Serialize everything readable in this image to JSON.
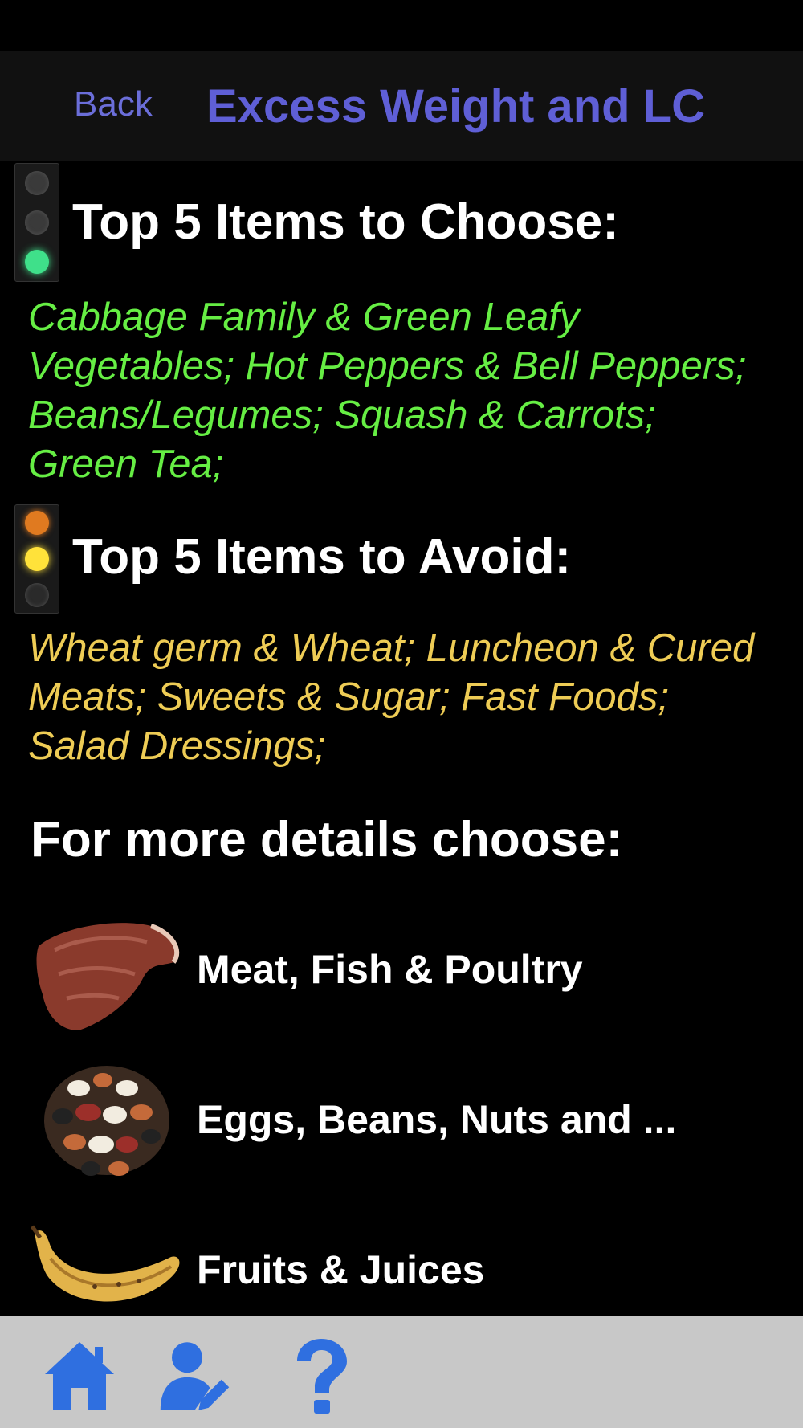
{
  "nav": {
    "back_label": "Back",
    "title": "Excess Weight and LC"
  },
  "choose_section": {
    "title": "Top 5 Items to Choose:",
    "items_text": "Cabbage Family & Green Leafy Vegetables; Hot Peppers & Bell Peppers; Beans/Legumes; Squash & Carrots; Green Tea;",
    "indicator_icon": "traffic-light-green",
    "text_color": "#66ee44"
  },
  "avoid_section": {
    "title": "Top 5 Items to Avoid:",
    "items_text": "Wheat germ & Wheat; Luncheon & Cured Meats; Sweets & Sugar; Fast Foods; Salad Dressings;",
    "indicator_icon": "traffic-light-yellow",
    "text_color": "#eecc55"
  },
  "details": {
    "heading": "For more details choose:",
    "categories": [
      {
        "label": "Meat, Fish & Poultry",
        "icon": "steak-icon"
      },
      {
        "label": "Eggs, Beans, Nuts and ...",
        "icon": "beans-icon"
      },
      {
        "label": "Fruits & Juices",
        "icon": "banana-icon"
      }
    ]
  },
  "tab_bar": {
    "items": [
      {
        "icon": "home-icon"
      },
      {
        "icon": "edit-profile-icon"
      },
      {
        "icon": "help-icon"
      }
    ],
    "accent": "#2f6fe0"
  }
}
